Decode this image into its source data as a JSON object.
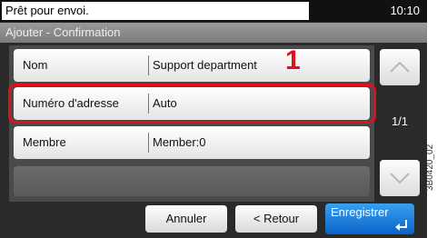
{
  "status": {
    "message": "Prêt pour envoi.",
    "time": "10:10"
  },
  "title": "Ajouter - Confirmation",
  "rows": [
    {
      "label": "Nom",
      "value": "Support department"
    },
    {
      "label": "Numéro d'adresse",
      "value": "Auto"
    },
    {
      "label": "Membre",
      "value": "Member:0"
    }
  ],
  "page_indicator": "1/1",
  "callout_number": "1",
  "buttons": {
    "cancel": "Annuler",
    "back": "< Retour",
    "save": "Enregistrer"
  },
  "figure_code": "3B0420_02",
  "colors": {
    "highlight": "#e0101a",
    "save_button": "#1a78d8"
  }
}
